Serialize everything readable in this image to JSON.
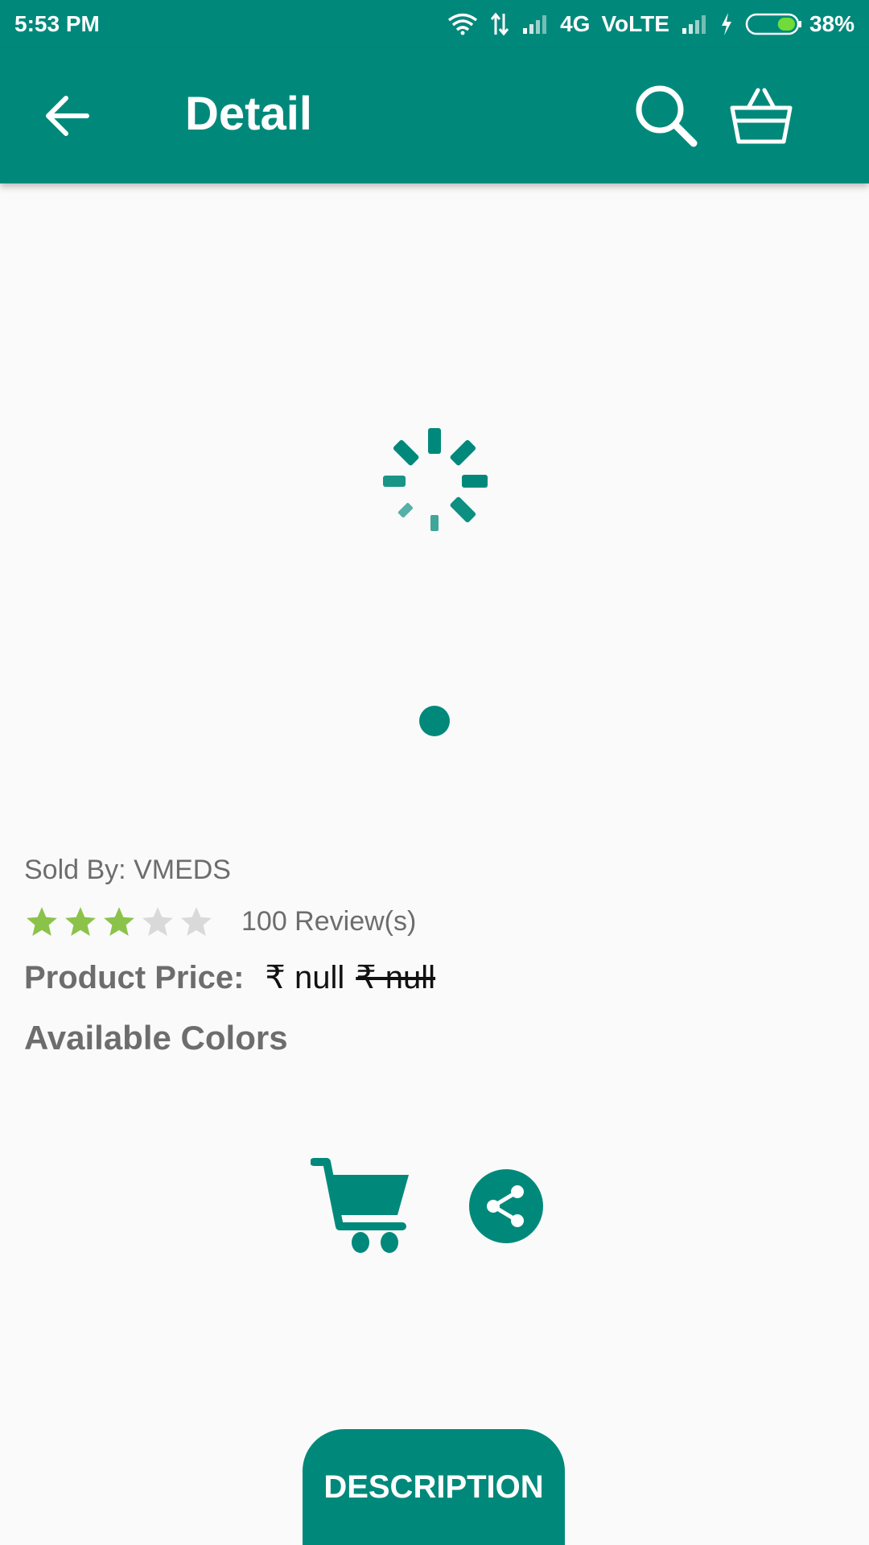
{
  "status_bar": {
    "time": "5:53 PM",
    "network": "4G",
    "volte": "VoLTE",
    "battery": "38%",
    "battery_level": 0.38,
    "icons": [
      "wifi-icon",
      "data-arrows-icon",
      "signal-icon",
      "signal-icon",
      "charging-icon",
      "battery-icon"
    ]
  },
  "app_bar": {
    "title": "Detail",
    "back_icon": "arrow-left-icon",
    "search_icon": "search-icon",
    "cart_icon": "shopping-basket-icon"
  },
  "product": {
    "sold_by": "Sold By: VMEDS",
    "rating": 3,
    "rating_max": 5,
    "reviews": "100 Review(s)",
    "price_label": "Product Price:",
    "price_current": "₹ null",
    "price_original": "₹ null",
    "colors_label": "Available Colors"
  },
  "actions": {
    "add_to_cart_icon": "cart-icon",
    "share_icon": "share-icon"
  },
  "tabs": {
    "description": "DESCRIPTION"
  },
  "colors": {
    "primary": "#00897b",
    "star_filled": "#8bc34a",
    "star_empty": "#d9d9d9",
    "text_gray": "#6d6d6d"
  }
}
